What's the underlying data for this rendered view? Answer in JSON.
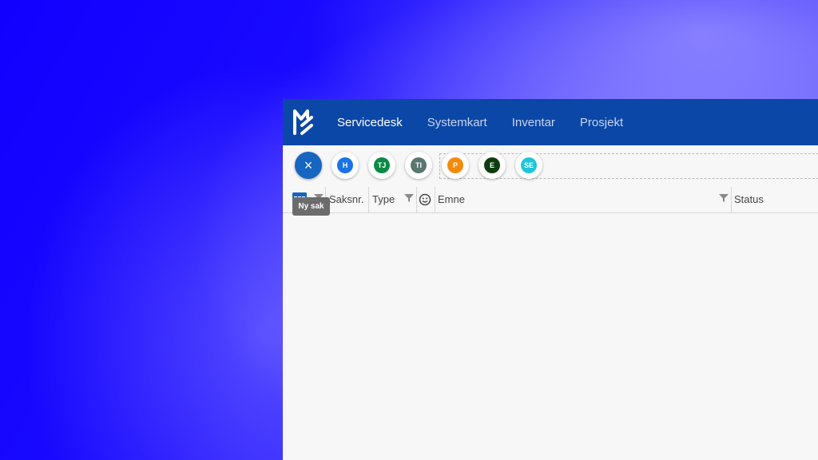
{
  "nav": {
    "items": [
      {
        "label": "Servicedesk",
        "active": true
      },
      {
        "label": "Systemkart",
        "active": false
      },
      {
        "label": "Inventar",
        "active": false
      },
      {
        "label": "Prosjekt",
        "active": false
      }
    ]
  },
  "toolbar": {
    "close_label": "×",
    "chips": [
      {
        "initials": "H",
        "color": "#1a73e8"
      },
      {
        "initials": "TJ",
        "color": "#0b8a47"
      },
      {
        "initials": "TI",
        "color": "#5a7671"
      },
      {
        "initials": "P",
        "color": "#f28b0c"
      },
      {
        "initials": "E",
        "color": "#0d3d0f"
      },
      {
        "initials": "SE",
        "color": "#1ec6d6"
      }
    ]
  },
  "table": {
    "columns": [
      {
        "label": "Saksnr."
      },
      {
        "label": "Type"
      },
      {
        "label": "Emne"
      },
      {
        "label": "Status"
      }
    ]
  },
  "tooltip": {
    "text": "Ny sak"
  },
  "colors": {
    "nav_background": "#0b47a6",
    "accent": "#1665c0",
    "app_background": "#f7f7f7"
  }
}
